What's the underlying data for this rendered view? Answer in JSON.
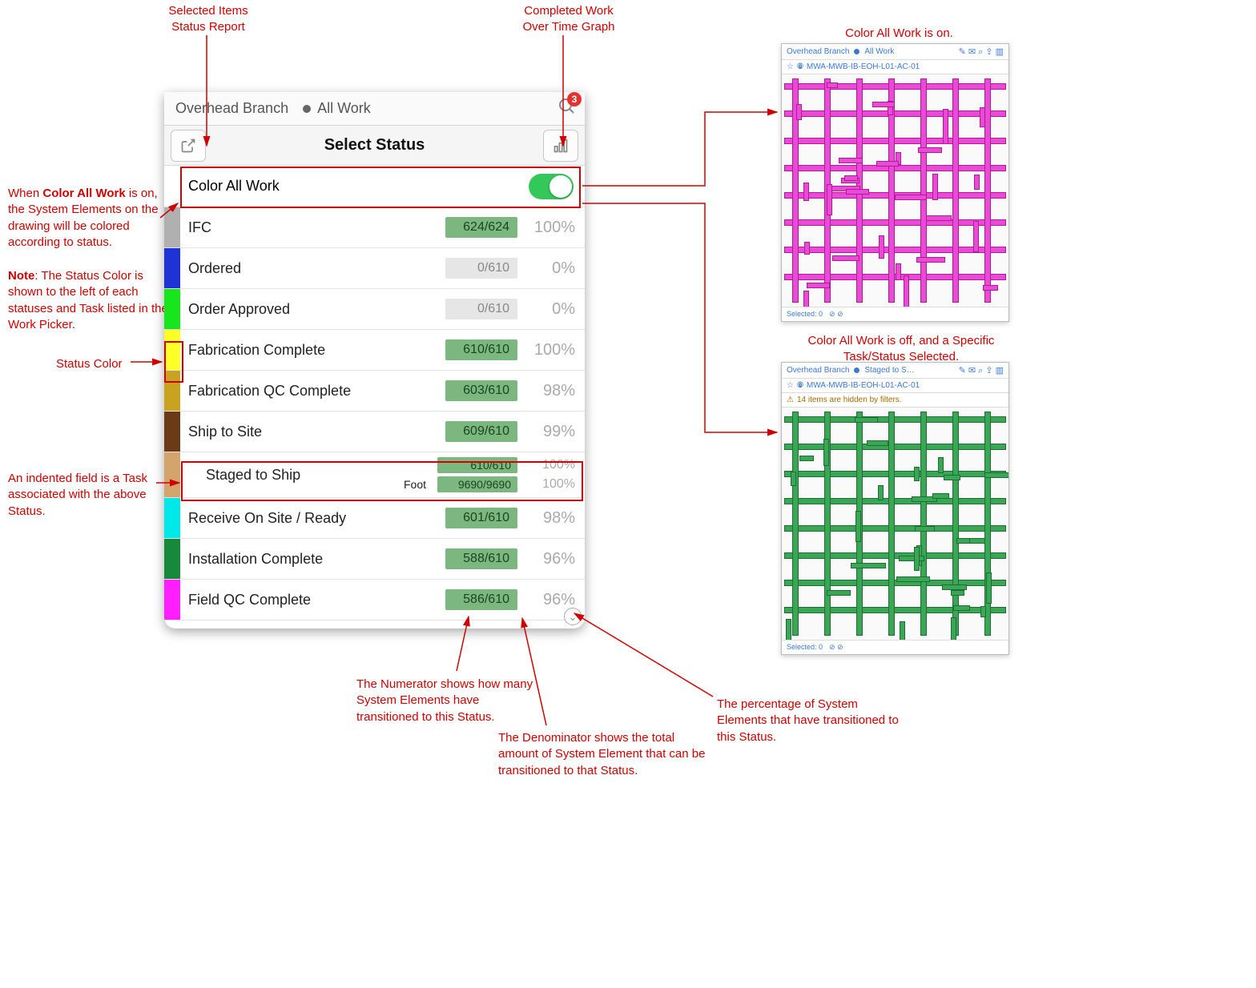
{
  "annotations": {
    "report": "Selected Items\nStatus Report",
    "graph": "Completed Work\nOver Time Graph",
    "color_all_explain_pre": "When ",
    "color_all_explain_bold": "Color All Work",
    "color_all_explain_post": " is on, the System Elements on the drawing will be colored according to status.",
    "note_prefix": "Note",
    "note_body": ": The Status Color is shown to the left of each statuses and Task listed in the Work Picker.",
    "status_color": "Status Color",
    "indented_task": "An indented field is a Task associated with the above Status.",
    "numerator": "The Numerator shows how many System Elements have transitioned to this Status.",
    "denominator": "The Denominator shows the total amount of System Element that can be transitioned to that Status.",
    "percentage": "The percentage of System Elements that have transitioned to this Status.",
    "thumb_on": "Color All Work is on.",
    "thumb_off": "Color All Work is off, and a Specific Task/Status Selected."
  },
  "device": {
    "breadcrumb_left": "Overhead Branch",
    "breadcrumb_right": "All Work",
    "badge": "3",
    "header_title": "Select Status",
    "color_all_label": "Color All Work",
    "color_all_on": true,
    "statuses": [
      {
        "label": "IFC",
        "swatch": "#b0b0b0",
        "frac": "624/624",
        "pct": "100%",
        "bar": "green"
      },
      {
        "label": "Ordered",
        "swatch": "#1e32d6",
        "frac": "0/610",
        "pct": "0%",
        "bar": "grey"
      },
      {
        "label": "Order Approved",
        "swatch": "#18e61c",
        "frac": "0/610",
        "pct": "0%",
        "bar": "grey"
      },
      {
        "label": "Fabrication Complete",
        "swatch": "#ffff28",
        "frac": "610/610",
        "pct": "100%",
        "bar": "green"
      },
      {
        "label": "Fabrication QC Complete",
        "swatch": "#c9a21f",
        "frac": "603/610",
        "pct": "98%",
        "bar": "green"
      },
      {
        "label": "Ship to Site",
        "swatch": "#6b3a16",
        "frac": "609/610",
        "pct": "99%",
        "bar": "green"
      },
      {
        "type": "task",
        "label": "Staged to Ship",
        "swatch": "#d3a46c",
        "line1": {
          "frac": "610/610",
          "pct": "100%",
          "bar": "green"
        },
        "line2": {
          "unit": "Foot",
          "frac": "9690/9690",
          "pct": "100%",
          "bar": "green"
        }
      },
      {
        "label": "Receive On Site / Ready",
        "swatch": "#00e8e8",
        "frac": "601/610",
        "pct": "98%",
        "bar": "green"
      },
      {
        "label": "Installation Complete",
        "swatch": "#168a3a",
        "frac": "588/610",
        "pct": "96%",
        "bar": "green"
      },
      {
        "label": "Field QC Complete",
        "swatch": "#ff1eff",
        "frac": "586/610",
        "pct": "96%",
        "bar": "green"
      }
    ]
  },
  "thumbs": {
    "t1": {
      "bc_left": "Overhead Branch",
      "bc_right": "All Work",
      "doc": "MWA-MWB-IB-EOH-L01-AC-01",
      "footer_sel": "Selected: 0",
      "stage_label": "Staged to S…"
    },
    "t2": {
      "bc_left": "Overhead Branch",
      "bc_right": "Staged to S…",
      "doc": "MWA-MWB-IB-EOH-L01-AC-01",
      "info": "14 items are hidden by filters.",
      "footer_sel": "Selected: 0"
    }
  }
}
